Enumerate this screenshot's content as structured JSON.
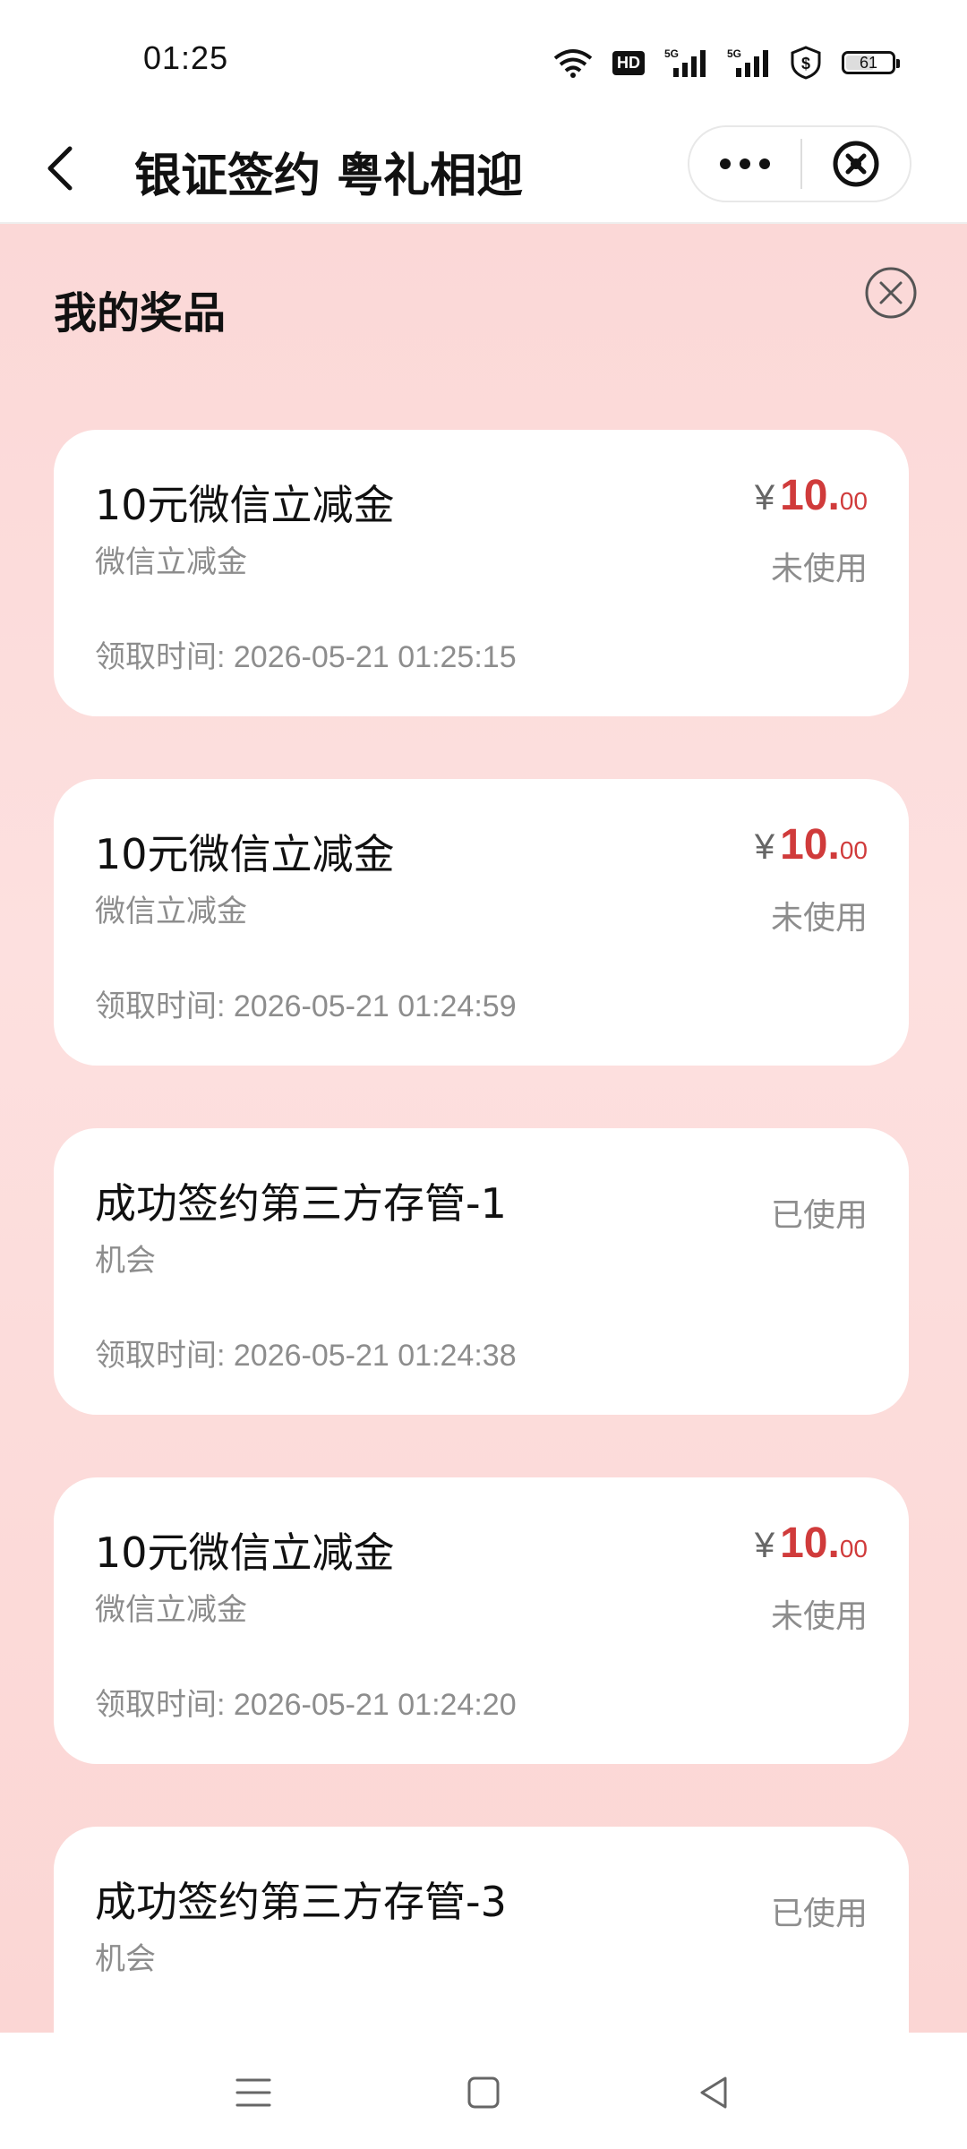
{
  "status_bar": {
    "time": "01:25",
    "hd_label": "HD",
    "signal_1_label": "5G",
    "signal_2_label": "5G",
    "battery": "61"
  },
  "header": {
    "title": "银证签约 粤礼相迎"
  },
  "panel": {
    "title": "我的奖品"
  },
  "prizes": [
    {
      "name": "10元微信立减金",
      "sub": "微信立减金",
      "time": "领取时间: 2026-05-21 01:25:15",
      "price_symbol": "¥",
      "price_int": "10.",
      "price_dec": "00",
      "status": "未使用"
    },
    {
      "name": "10元微信立减金",
      "sub": "微信立减金",
      "time": "领取时间: 2026-05-21 01:24:59",
      "price_symbol": "¥",
      "price_int": "10.",
      "price_dec": "00",
      "status": "未使用"
    },
    {
      "name": "成功签约第三方存管-1",
      "sub": "机会",
      "time": "领取时间: 2026-05-21 01:24:38",
      "status": "已使用"
    },
    {
      "name": "10元微信立减金",
      "sub": "微信立减金",
      "time": "领取时间: 2026-05-21 01:24:20",
      "price_symbol": "¥",
      "price_int": "10.",
      "price_dec": "00",
      "status": "未使用"
    },
    {
      "name": "成功签约第三方存管-3",
      "sub": "机会",
      "status": "已使用"
    }
  ],
  "colors": {
    "accent": "#d03b3b",
    "background_top": "#fbd8d7",
    "card": "#ffffff",
    "muted_text": "#8d8d8d"
  }
}
